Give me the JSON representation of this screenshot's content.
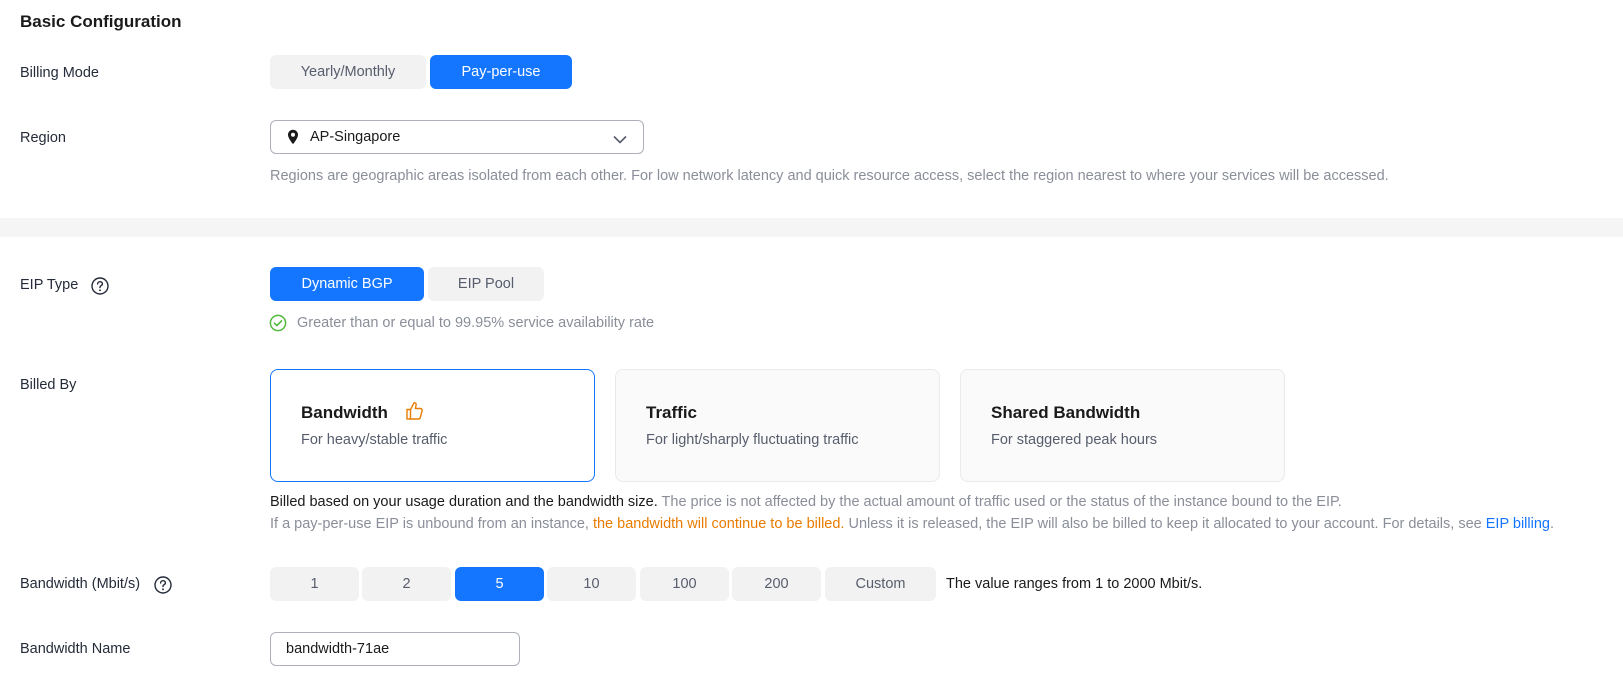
{
  "section_title": "Basic Configuration",
  "billing_mode": {
    "label": "Billing Mode",
    "options": [
      "Yearly/Monthly",
      "Pay-per-use"
    ],
    "selected": "Pay-per-use"
  },
  "region": {
    "label": "Region",
    "value": "AP-Singapore",
    "hint": "Regions are geographic areas isolated from each other. For low network latency and quick resource access, select the region nearest to where your services will be accessed."
  },
  "eip_type": {
    "label": "EIP Type",
    "options": [
      "Dynamic BGP",
      "EIP Pool"
    ],
    "selected": "Dynamic BGP",
    "availability_note": "Greater than or equal to 99.95% service availability rate"
  },
  "billed_by": {
    "label": "Billed By",
    "cards": [
      {
        "title": "Bandwidth",
        "desc": "For heavy/stable traffic"
      },
      {
        "title": "Traffic",
        "desc": "For light/sharply fluctuating traffic"
      },
      {
        "title": "Shared Bandwidth",
        "desc": "For staggered peak hours"
      }
    ],
    "selected": "Bandwidth",
    "note1_dark": "Billed based on your usage duration and the bandwidth size.",
    "note1_grey": " The price is not affected by the actual amount of traffic used or the status of the instance bound to the EIP.",
    "note2_a": "If a pay-per-use EIP is unbound from an instance, ",
    "note2_orange": "the bandwidth will continue to be billed.",
    "note2_b": " Unless it is released, the EIP will also be billed to keep it allocated to your account. For details, see ",
    "note2_link": "EIP billing",
    "note2_end": "."
  },
  "bandwidth": {
    "label": "Bandwidth (Mbit/s)",
    "options": [
      "1",
      "2",
      "5",
      "10",
      "100",
      "200",
      "Custom"
    ],
    "selected": "5",
    "range_text": "The value ranges from 1 to 2000 Mbit/s."
  },
  "bandwidth_name": {
    "label": "Bandwidth Name",
    "value": "bandwidth-71ae"
  },
  "colors": {
    "accent": "#1476ff",
    "warning": "#e87c00",
    "success": "#50b83c"
  },
  "icons": {
    "region_pin": "location-pin-icon",
    "region_chevron": "chevron-down-icon",
    "help": "question-circle-icon",
    "availability": "check-circle-icon",
    "recommended": "thumbs-up-icon"
  }
}
